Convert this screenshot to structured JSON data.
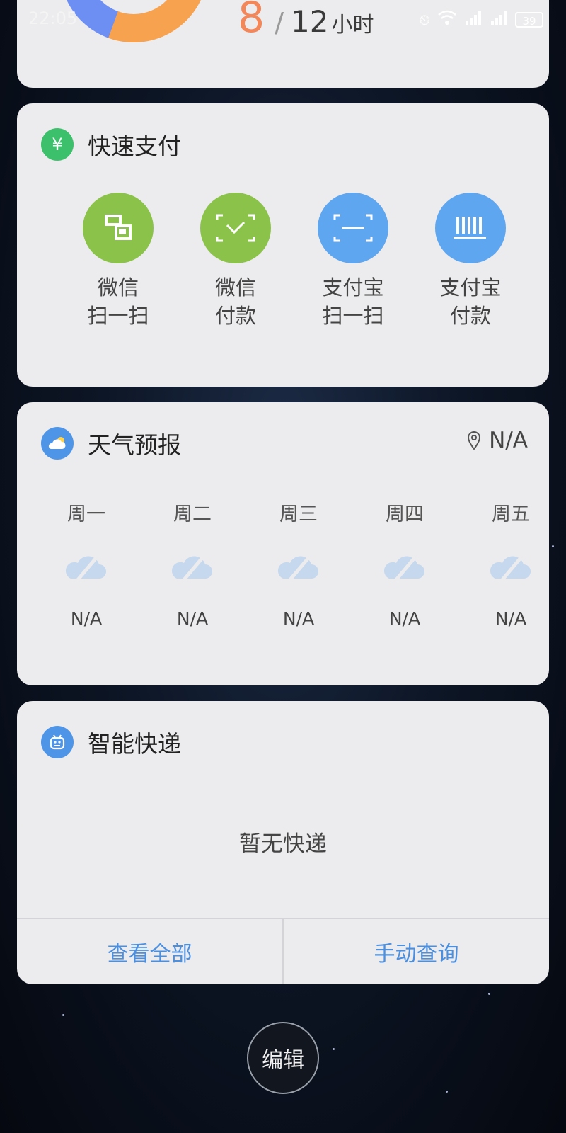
{
  "status_bar": {
    "time": "22:05",
    "battery": "39",
    "icons": [
      "alarm-icon",
      "wifi-icon",
      "signal-4g-icon",
      "signal-4g-icon",
      "battery-icon"
    ]
  },
  "sleep_card": {
    "current": "8",
    "separator": "/",
    "total": "12",
    "unit": "小时"
  },
  "quick_pay": {
    "title": "快速支付",
    "icon": "yuan-icon",
    "items": [
      {
        "line1": "微信",
        "line2": "扫一扫",
        "icon": "wechat-scan-icon",
        "color": "#8bc34a"
      },
      {
        "line1": "微信",
        "line2": "付款",
        "icon": "wechat-pay-icon",
        "color": "#8bc34a"
      },
      {
        "line1": "支付宝",
        "line2": "扫一扫",
        "icon": "alipay-scan-icon",
        "color": "#5ea6f0"
      },
      {
        "line1": "支付宝",
        "line2": "付款",
        "icon": "alipay-pay-icon",
        "color": "#5ea6f0"
      }
    ]
  },
  "weather": {
    "title": "天气预报",
    "icon": "weather-icon",
    "location": "N/A",
    "days": [
      {
        "name": "周一",
        "temp": "N/A"
      },
      {
        "name": "周二",
        "temp": "N/A"
      },
      {
        "name": "周三",
        "temp": "N/A"
      },
      {
        "name": "周四",
        "temp": "N/A"
      },
      {
        "name": "周五",
        "temp": "N/A"
      }
    ]
  },
  "express": {
    "title": "智能快递",
    "icon": "express-robot-icon",
    "empty_text": "暂无快递",
    "view_all": "查看全部",
    "manual_query": "手动查询"
  },
  "edit_button": "编辑"
}
